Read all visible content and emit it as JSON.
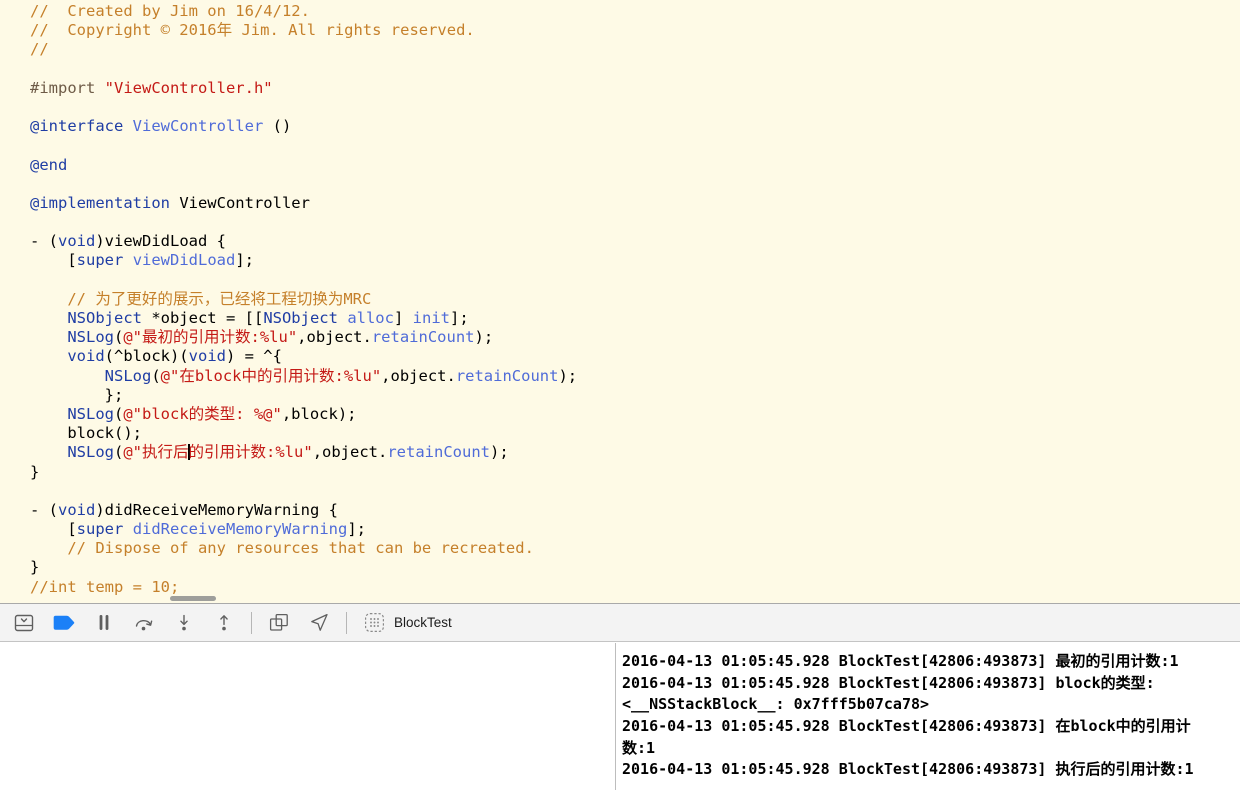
{
  "colors": {
    "editor_background": "#FEFAE6",
    "comment": "#C5802B",
    "keyword": "#1F3DA4",
    "method": "#4F6BD8",
    "string": "#C41A16",
    "preprocessor": "#6E5B47",
    "plain": "#000000",
    "breakpoint_blue": "#1B80F7"
  },
  "editor": {
    "lines": [
      {
        "seg": [
          {
            "t": "//  Created by Jim on 16/4/12.",
            "c": "c"
          }
        ]
      },
      {
        "seg": [
          {
            "t": "//  Copyright © 2016年 Jim. All rights reserved.",
            "c": "c"
          }
        ]
      },
      {
        "seg": [
          {
            "t": "//",
            "c": "c"
          }
        ]
      },
      {
        "seg": []
      },
      {
        "seg": [
          {
            "t": "#import ",
            "c": "pre"
          },
          {
            "t": "\"ViewController.h\"",
            "c": "s"
          }
        ]
      },
      {
        "seg": []
      },
      {
        "seg": [
          {
            "t": "@interface ",
            "c": "k"
          },
          {
            "t": "ViewController",
            "c": "m"
          },
          {
            "t": " ()",
            "c": "p"
          }
        ]
      },
      {
        "seg": []
      },
      {
        "seg": [
          {
            "t": "@end",
            "c": "k"
          }
        ]
      },
      {
        "seg": []
      },
      {
        "seg": [
          {
            "t": "@implementation ",
            "c": "k"
          },
          {
            "t": "ViewController",
            "c": "p"
          }
        ]
      },
      {
        "seg": []
      },
      {
        "seg": [
          {
            "t": "- (",
            "c": "p"
          },
          {
            "t": "void",
            "c": "k"
          },
          {
            "t": ")viewDidLoad {",
            "c": "p"
          }
        ]
      },
      {
        "seg": [
          {
            "t": "    [",
            "c": "p"
          },
          {
            "t": "super",
            "c": "k"
          },
          {
            "t": " ",
            "c": "p"
          },
          {
            "t": "viewDidLoad",
            "c": "m"
          },
          {
            "t": "];",
            "c": "p"
          }
        ]
      },
      {
        "seg": []
      },
      {
        "seg": [
          {
            "t": "    ",
            "c": "p"
          },
          {
            "t": "// 为了更好的展示，已经将工程切换为MRC",
            "c": "c"
          }
        ]
      },
      {
        "seg": [
          {
            "t": "    ",
            "c": "p"
          },
          {
            "t": "NSObject",
            "c": "k"
          },
          {
            "t": " *object = [[",
            "c": "p"
          },
          {
            "t": "NSObject",
            "c": "k"
          },
          {
            "t": " ",
            "c": "p"
          },
          {
            "t": "alloc",
            "c": "m"
          },
          {
            "t": "] ",
            "c": "p"
          },
          {
            "t": "init",
            "c": "m"
          },
          {
            "t": "];",
            "c": "p"
          }
        ]
      },
      {
        "seg": [
          {
            "t": "    ",
            "c": "p"
          },
          {
            "t": "NSLog",
            "c": "k"
          },
          {
            "t": "(",
            "c": "p"
          },
          {
            "t": "@\"最初的引用计数:%lu\"",
            "c": "s"
          },
          {
            "t": ",object.",
            "c": "p"
          },
          {
            "t": "retainCount",
            "c": "m"
          },
          {
            "t": ");",
            "c": "p"
          }
        ]
      },
      {
        "seg": [
          {
            "t": "    ",
            "c": "p"
          },
          {
            "t": "void",
            "c": "k"
          },
          {
            "t": "(^block)(",
            "c": "p"
          },
          {
            "t": "void",
            "c": "k"
          },
          {
            "t": ") = ^{",
            "c": "p"
          }
        ]
      },
      {
        "seg": [
          {
            "t": "        ",
            "c": "p"
          },
          {
            "t": "NSLog",
            "c": "k"
          },
          {
            "t": "(",
            "c": "p"
          },
          {
            "t": "@\"在block中的引用计数:%lu\"",
            "c": "s"
          },
          {
            "t": ",object.",
            "c": "p"
          },
          {
            "t": "retainCount",
            "c": "m"
          },
          {
            "t": ");",
            "c": "p"
          }
        ]
      },
      {
        "seg": [
          {
            "t": "        };",
            "c": "p"
          }
        ]
      },
      {
        "seg": [
          {
            "t": "    ",
            "c": "p"
          },
          {
            "t": "NSLog",
            "c": "k"
          },
          {
            "t": "(",
            "c": "p"
          },
          {
            "t": "@\"block的类型: %@\"",
            "c": "s"
          },
          {
            "t": ",block);",
            "c": "p"
          }
        ]
      },
      {
        "seg": [
          {
            "t": "    block();",
            "c": "p"
          }
        ]
      },
      {
        "seg": [
          {
            "t": "    ",
            "c": "p"
          },
          {
            "t": "NSLog",
            "c": "k"
          },
          {
            "t": "(",
            "c": "p"
          },
          {
            "t": "@\"执行后",
            "c": "s"
          },
          {
            "c": "cur"
          },
          {
            "t": "的引用计数:%lu\"",
            "c": "s"
          },
          {
            "t": ",object.",
            "c": "p"
          },
          {
            "t": "retainCount",
            "c": "m"
          },
          {
            "t": ");",
            "c": "p"
          }
        ]
      },
      {
        "seg": [
          {
            "t": "}",
            "c": "p"
          }
        ]
      },
      {
        "seg": []
      },
      {
        "seg": [
          {
            "t": "- (",
            "c": "p"
          },
          {
            "t": "void",
            "c": "k"
          },
          {
            "t": ")didReceiveMemoryWarning {",
            "c": "p"
          }
        ]
      },
      {
        "seg": [
          {
            "t": "    [",
            "c": "p"
          },
          {
            "t": "super",
            "c": "k"
          },
          {
            "t": " ",
            "c": "p"
          },
          {
            "t": "didReceiveMemoryWarning",
            "c": "m"
          },
          {
            "t": "];",
            "c": "p"
          }
        ]
      },
      {
        "seg": [
          {
            "t": "    ",
            "c": "p"
          },
          {
            "t": "// Dispose of any resources that can be recreated.",
            "c": "c"
          }
        ]
      },
      {
        "seg": [
          {
            "t": "}",
            "c": "p"
          }
        ]
      },
      {
        "seg": [
          {
            "t": "//int temp = 10;",
            "c": "c"
          }
        ]
      }
    ]
  },
  "toolbar": {
    "app_label": "BlockTest",
    "icons": [
      "hide-debug-area",
      "toggle-breakpoints",
      "pause",
      "step-over",
      "step-into",
      "step-out",
      "debug-view-hierarchy",
      "simulate-location",
      "app-icon"
    ]
  },
  "console": {
    "lines": [
      "2016-04-13 01:05:45.928 BlockTest[42806:493873] 最初的引用计数:1",
      "2016-04-13 01:05:45.928 BlockTest[42806:493873] block的类型:",
      "<__NSStackBlock__: 0x7fff5b07ca78>",
      "2016-04-13 01:05:45.928 BlockTest[42806:493873] 在block中的引用计",
      "数:1",
      "2016-04-13 01:05:45.928 BlockTest[42806:493873] 执行后的引用计数:1"
    ]
  }
}
